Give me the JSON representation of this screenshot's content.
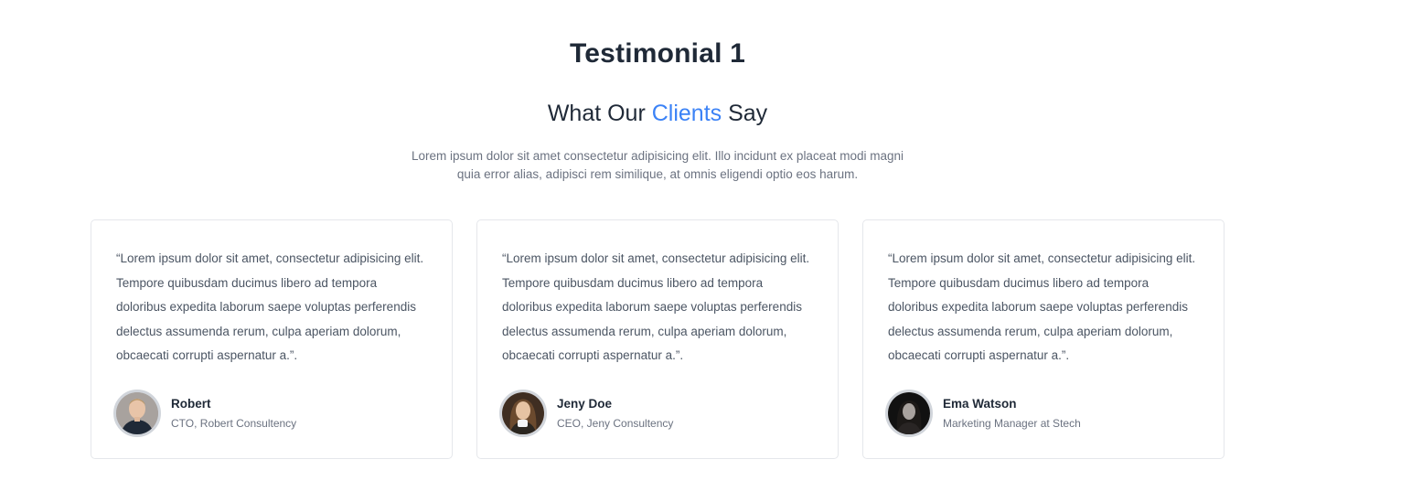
{
  "header": {
    "title": "Testimonial 1",
    "subtitle_before": "What Our ",
    "subtitle_accent": "Clients",
    "subtitle_after": " Say",
    "intro": "Lorem ipsum dolor sit amet consectetur adipisicing elit. Illo incidunt ex placeat modi magni quia error alias, adipisci rem similique, at omnis eligendi optio eos harum."
  },
  "testimonials": [
    {
      "quote": "“Lorem ipsum dolor sit amet, consectetur adipisicing elit. Tempore quibusdam ducimus libero ad tempora doloribus expedita laborum saepe voluptas perferendis delectus assumenda rerum, culpa aperiam dolorum, obcaecati corrupti aspernatur a.”.",
      "name": "Robert",
      "role": "CTO, Robert Consultency"
    },
    {
      "quote": "“Lorem ipsum dolor sit amet, consectetur adipisicing elit. Tempore quibusdam ducimus libero ad tempora doloribus expedita laborum saepe voluptas perferendis delectus assumenda rerum, culpa aperiam dolorum, obcaecati corrupti aspernatur a.”.",
      "name": "Jeny Doe",
      "role": "CEO, Jeny Consultency"
    },
    {
      "quote": "“Lorem ipsum dolor sit amet, consectetur adipisicing elit. Tempore quibusdam ducimus libero ad tempora doloribus expedita laborum saepe voluptas perferendis delectus assumenda rerum, culpa aperiam dolorum, obcaecati corrupti aspernatur a.”.",
      "name": "Ema Watson",
      "role": "Marketing Manager at Stech"
    }
  ],
  "colors": {
    "accent": "#3b82f6",
    "heading": "#1f2937",
    "body_text": "#6b7280",
    "card_border": "#e5e7eb"
  }
}
